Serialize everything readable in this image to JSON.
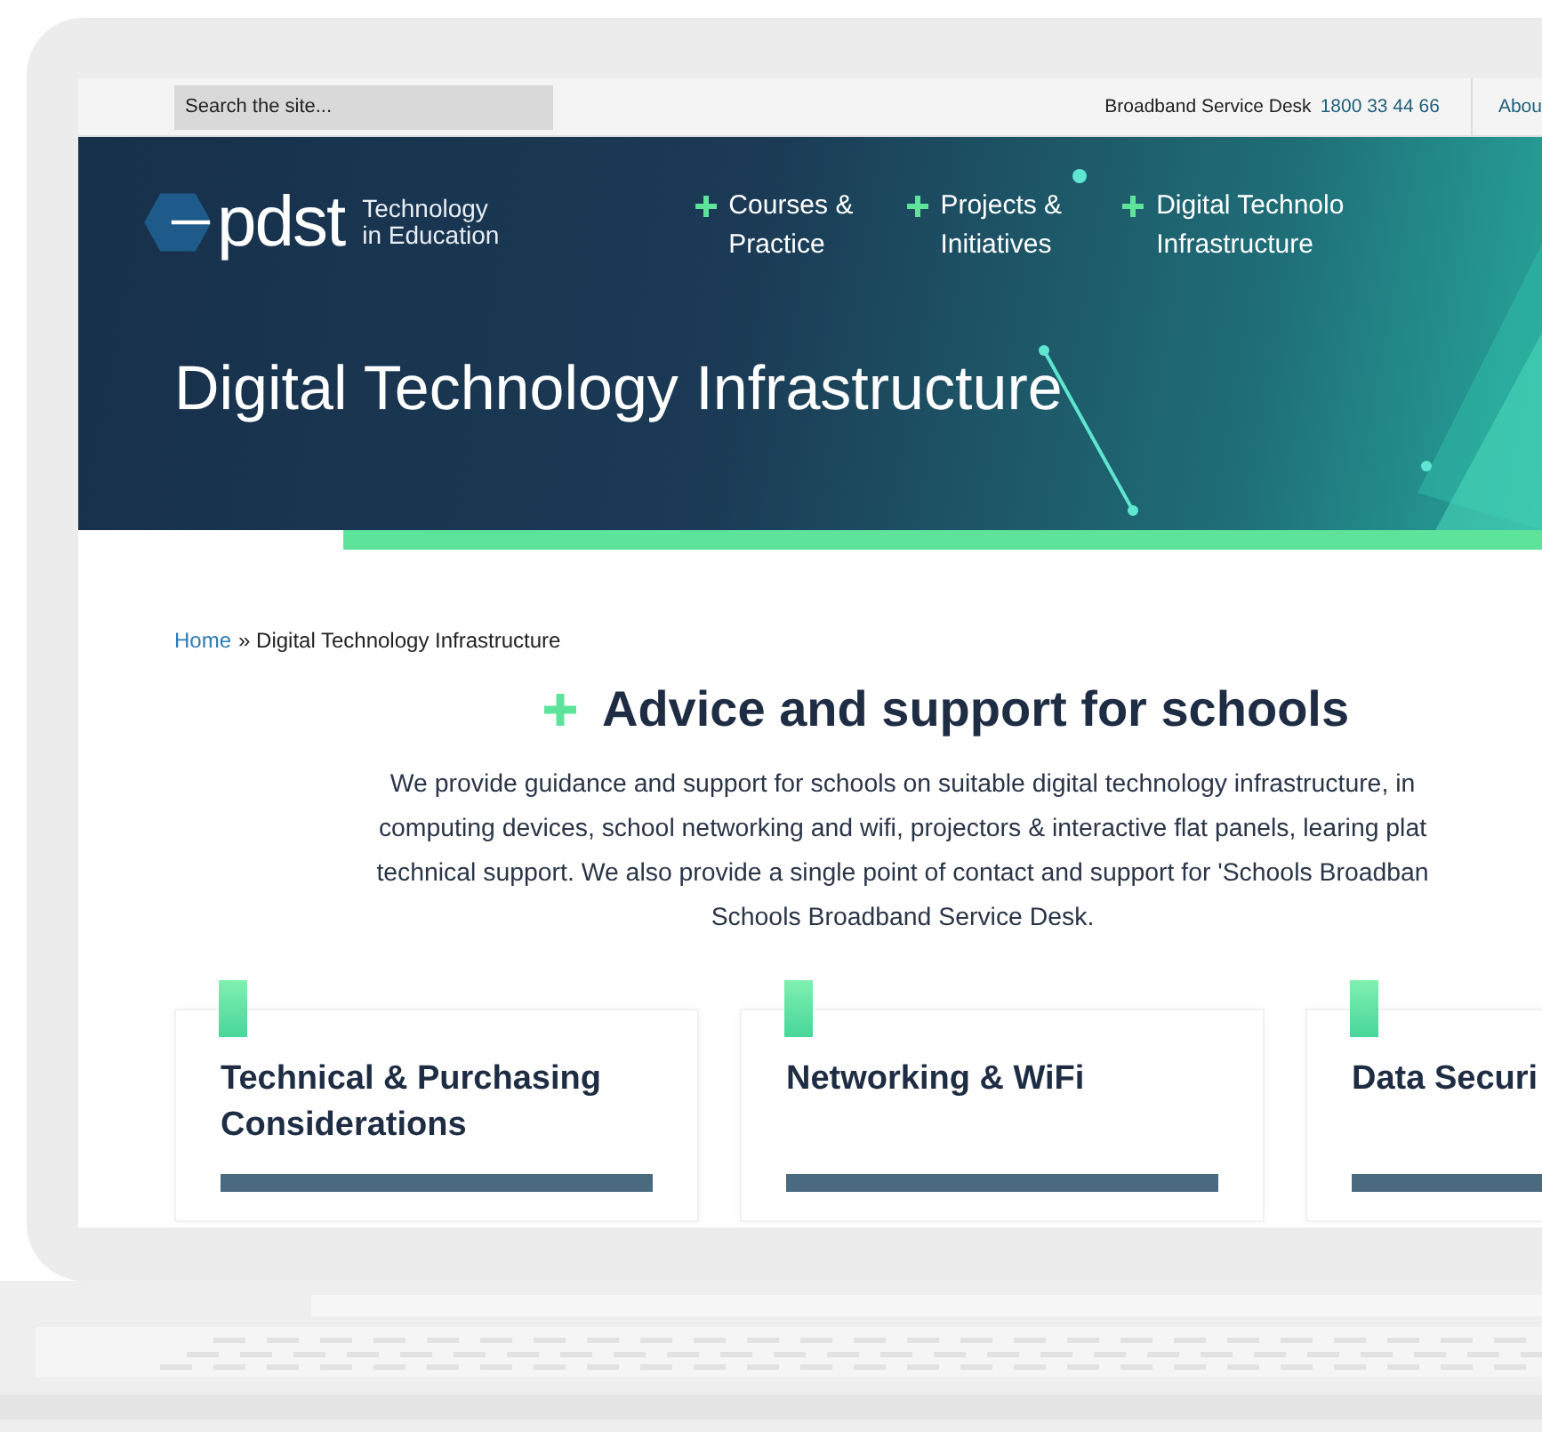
{
  "search": {
    "placeholder": "Search the site..."
  },
  "top_bar": {
    "label": "Broadband Service Desk",
    "phone": "1800 33 44 66",
    "link": "Abou"
  },
  "logo": {
    "wordmark": "pdst",
    "tagline": [
      "Technology",
      "in Education"
    ]
  },
  "nav": [
    {
      "lines": [
        "Courses &",
        "Practice"
      ]
    },
    {
      "lines": [
        "Projects &",
        "Initiatives"
      ]
    },
    {
      "lines": [
        "Digital Technolo",
        "Infrastructure"
      ]
    }
  ],
  "hero": {
    "title": "Digital Technology Infrastructure"
  },
  "breadcrumb": {
    "home": "Home",
    "separator": "»",
    "current": "Digital Technology Infrastructure"
  },
  "section": {
    "heading": "Advice and support for schools",
    "paragraph_lines": [
      "We provide guidance and support for schools on suitable digital technology infrastructure, in",
      "computing devices, school networking and wifi, projectors & interactive flat panels, learing plat",
      "technical support. We also provide a single point of contact and support for 'Schools Broadban",
      "Schools Broadband Service Desk."
    ]
  },
  "cards": [
    {
      "title": "Technical & Purchasing Considerations"
    },
    {
      "title": "Networking & WiFi"
    },
    {
      "title": "Data Securi"
    }
  ]
}
